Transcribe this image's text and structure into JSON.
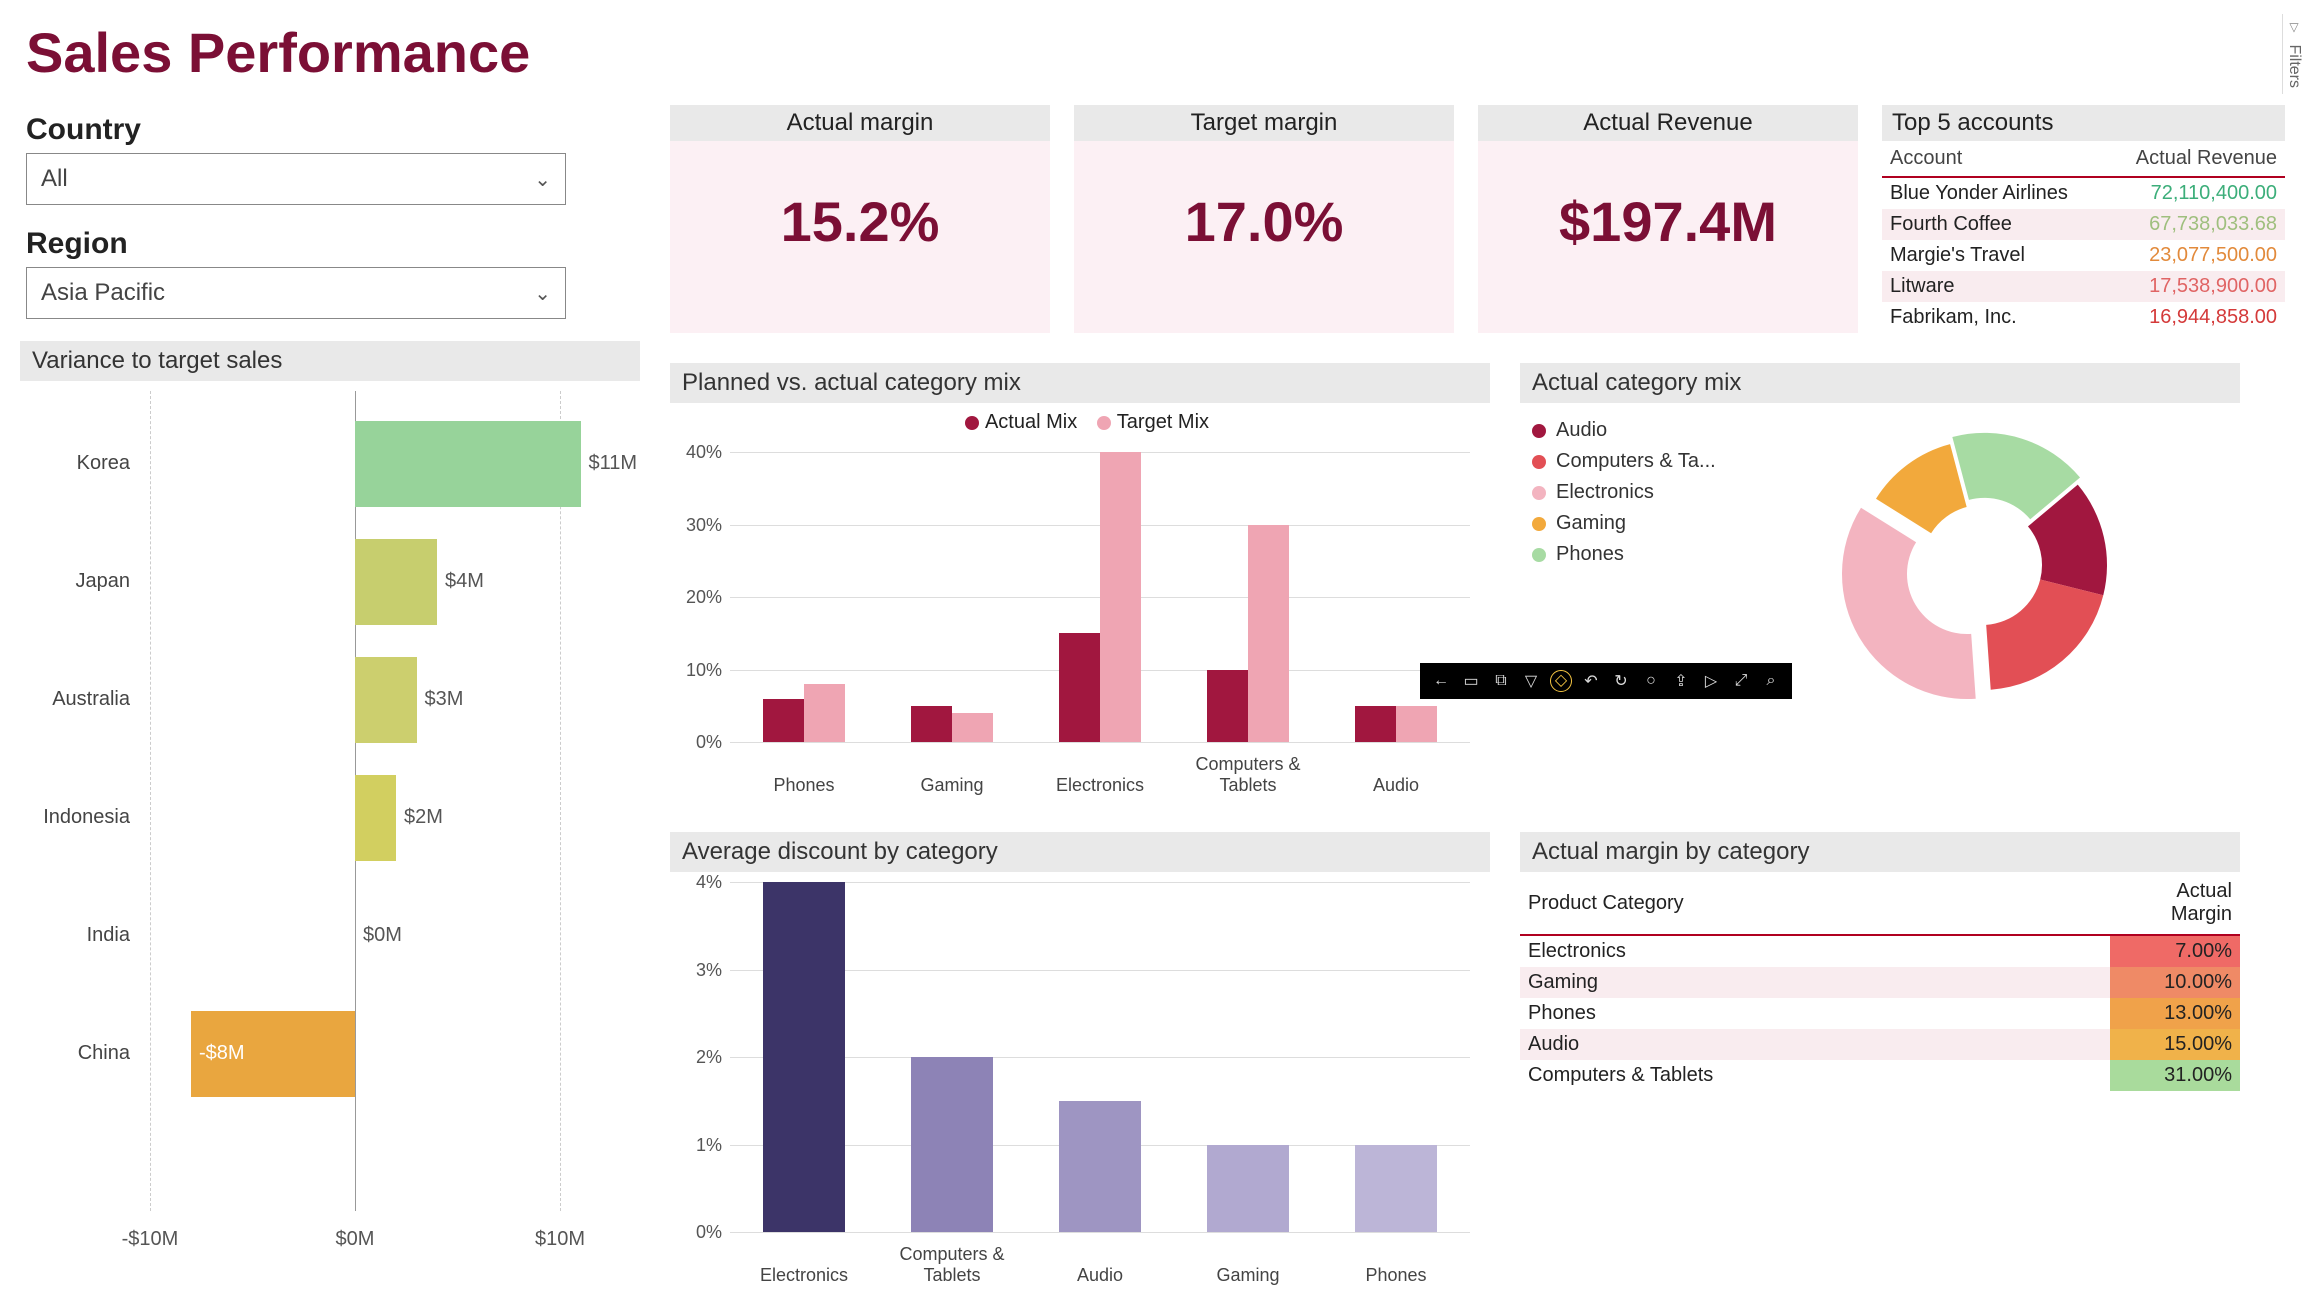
{
  "title": "Sales Performance",
  "filters": {
    "country_label": "Country",
    "country_value": "All",
    "region_label": "Region",
    "region_value": "Asia Pacific"
  },
  "kpis": {
    "actual_margin": {
      "label": "Actual margin",
      "value": "15.2%"
    },
    "target_margin": {
      "label": "Target margin",
      "value": "17.0%"
    },
    "actual_revenue": {
      "label": "Actual Revenue",
      "value": "$197.4M"
    }
  },
  "top5": {
    "title": "Top 5 accounts",
    "col_account": "Account",
    "col_revenue": "Actual Revenue",
    "rows": [
      {
        "account": "Blue Yonder Airlines",
        "revenue": "72,110,400.00",
        "color": "#3cae7a"
      },
      {
        "account": "Fourth Coffee",
        "revenue": "67,738,033.68",
        "color": "#9fbf7e",
        "alt": true
      },
      {
        "account": "Margie's Travel",
        "revenue": "23,077,500.00",
        "color": "#e28a3b"
      },
      {
        "account": "Litware",
        "revenue": "17,538,900.00",
        "color": "#e06464",
        "alt": true
      },
      {
        "account": "Fabrikam, Inc.",
        "revenue": "16,944,858.00",
        "color": "#d43a3a"
      }
    ]
  },
  "variance": {
    "title": "Variance to target sales",
    "xticks": [
      "-$10M",
      "$0M",
      "$10M"
    ]
  },
  "mix": {
    "title": "Planned vs. actual category mix",
    "legend_a": "Actual Mix",
    "legend_t": "Target Mix"
  },
  "category_mix": {
    "title": "Actual category mix",
    "legend": [
      "Audio",
      "Computers & Ta...",
      "Electronics",
      "Gaming",
      "Phones"
    ]
  },
  "discount": {
    "title": "Average discount by category"
  },
  "margin_table": {
    "title": "Actual margin by category",
    "col_cat": "Product Category",
    "col_margin": "Actual Margin",
    "rows": [
      {
        "cat": "Electronics",
        "margin": "7.00%",
        "bg": "#ef6a66"
      },
      {
        "cat": "Gaming",
        "margin": "10.00%",
        "bg": "#ef8a66",
        "alt": true
      },
      {
        "cat": "Phones",
        "margin": "13.00%",
        "bg": "#f0a24a"
      },
      {
        "cat": "Audio",
        "margin": "15.00%",
        "bg": "#f0b24a",
        "alt": true
      },
      {
        "cat": "Computers & Tablets",
        "margin": "31.00%",
        "bg": "#a9db9c"
      }
    ]
  },
  "filters_tab": "Filters",
  "toolbar_icons": [
    "←",
    "▭",
    "⧉",
    "▽",
    "◇",
    "↶",
    "↻",
    "○",
    "⇪",
    "▷",
    "⤢",
    "⌕"
  ],
  "chart_data": [
    {
      "name": "variance_to_target_sales",
      "type": "bar",
      "orientation": "horizontal",
      "categories": [
        "Korea",
        "Japan",
        "Australia",
        "Indonesia",
        "India",
        "China"
      ],
      "values": [
        11,
        4,
        3,
        2,
        0,
        -8
      ],
      "value_labels": [
        "$11M",
        "$4M",
        "$3M",
        "$2M",
        "$0M",
        "-$8M"
      ],
      "colors": [
        "#97d39a",
        "#c7ce6e",
        "#cccf6e",
        "#d2cf60",
        "#d7c647",
        "#e9a63f"
      ],
      "xlabel": "",
      "ylabel": "",
      "xlim": [
        -10,
        10
      ],
      "xticks": [
        -10,
        0,
        10
      ]
    },
    {
      "name": "planned_vs_actual_category_mix",
      "type": "bar",
      "categories": [
        "Phones",
        "Gaming",
        "Electronics",
        "Computers & Tablets",
        "Audio"
      ],
      "series": [
        {
          "name": "Actual Mix",
          "color": "#a1173f",
          "values": [
            6,
            5,
            15,
            10,
            5
          ]
        },
        {
          "name": "Target Mix",
          "color": "#efa5b3",
          "values": [
            8,
            4,
            40,
            30,
            5
          ]
        }
      ],
      "ylabel": "",
      "ylim": [
        0,
        40
      ],
      "yticks": [
        0,
        10,
        20,
        30,
        40
      ],
      "yformat": "percent"
    },
    {
      "name": "actual_category_mix",
      "type": "pie",
      "labels": [
        "Audio",
        "Computers & Tablets",
        "Electronics",
        "Gaming",
        "Phones"
      ],
      "colors": [
        "#a1173f",
        "#e24f55",
        "#f3b4c0",
        "#f2a93c",
        "#a7dba3"
      ],
      "values": [
        15,
        20,
        35,
        12,
        18
      ]
    },
    {
      "name": "average_discount_by_category",
      "type": "bar",
      "categories": [
        "Electronics",
        "Computers & Tablets",
        "Audio",
        "Gaming",
        "Phones"
      ],
      "values": [
        4.0,
        2.0,
        1.5,
        1.0,
        1.0
      ],
      "colors": [
        "#3c3468",
        "#8d83b6",
        "#9e95c2",
        "#b1a9d0",
        "#bcb5d7"
      ],
      "ylim": [
        0,
        4
      ],
      "yticks": [
        0,
        1,
        2,
        3,
        4
      ],
      "yformat": "percent"
    },
    {
      "name": "actual_margin_by_category",
      "type": "table",
      "columns": [
        "Product Category",
        "Actual Margin"
      ],
      "rows": [
        [
          "Electronics",
          "7.00%"
        ],
        [
          "Gaming",
          "10.00%"
        ],
        [
          "Phones",
          "13.00%"
        ],
        [
          "Audio",
          "15.00%"
        ],
        [
          "Computers & Tablets",
          "31.00%"
        ]
      ]
    }
  ]
}
